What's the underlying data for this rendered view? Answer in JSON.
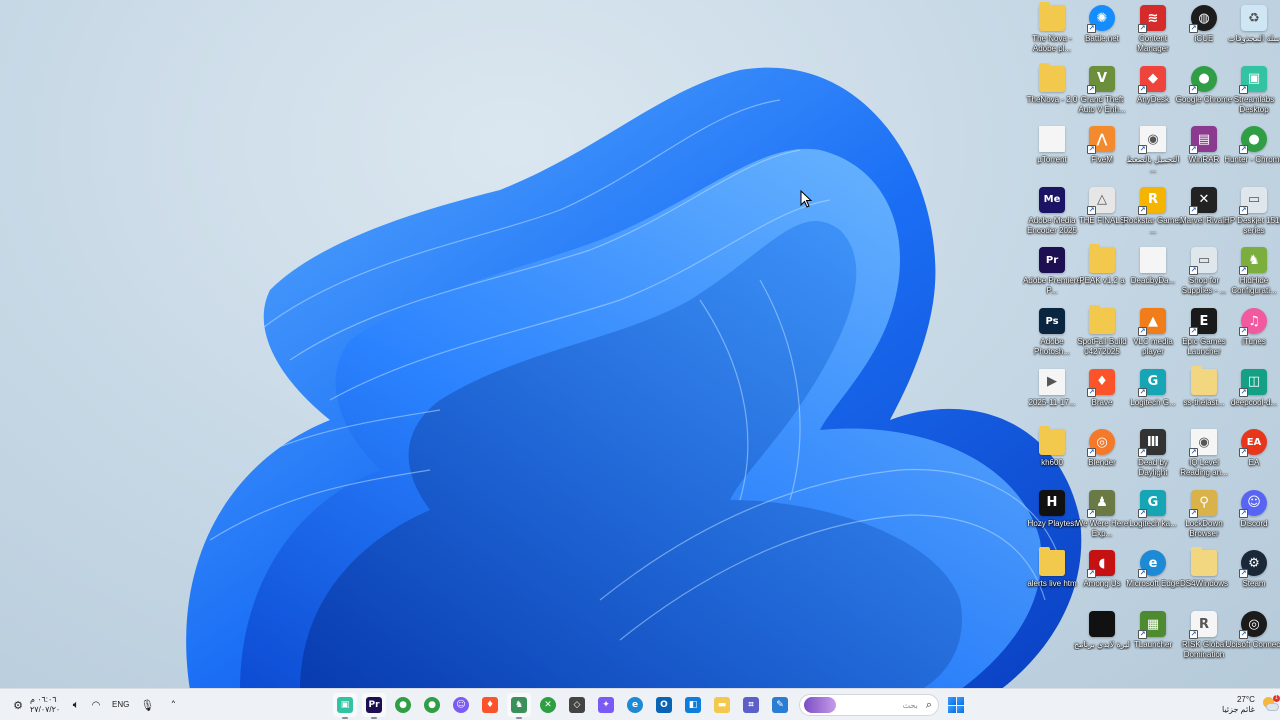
{
  "desktop_icons": [
    {
      "label": "The Nova - Adobe pl...",
      "col": 0,
      "row": 0,
      "color": "#f2c94c",
      "kind": "folder",
      "glyph": "",
      "shortcut": false
    },
    {
      "label": "Battle.net",
      "col": 1,
      "row": 0,
      "color": "#148eff",
      "kind": "round",
      "glyph": "✺",
      "shortcut": true
    },
    {
      "label": "Content Manager",
      "col": 2,
      "row": 0,
      "color": "#d62b2b",
      "kind": "tile",
      "glyph": "≋",
      "shortcut": true
    },
    {
      "label": "iCUE",
      "col": 3,
      "row": 0,
      "color": "#1d1d1d",
      "kind": "round",
      "glyph": "◍",
      "shortcut": true
    },
    {
      "label": "سلة المحذوفات",
      "col": 4,
      "row": 0,
      "color": "#cfe6f4",
      "kind": "tile",
      "glyph": "♻",
      "shortcut": false
    },
    {
      "label": "TheNova - 2.0",
      "col": 0,
      "row": 1,
      "color": "#f2c94c",
      "kind": "folder",
      "glyph": "",
      "shortcut": false
    },
    {
      "label": "Grand Theft Auto V Enh...",
      "col": 1,
      "row": 1,
      "color": "#6b8f3a",
      "kind": "tile",
      "glyph": "V",
      "shortcut": true
    },
    {
      "label": "AnyDesk",
      "col": 2,
      "row": 1,
      "color": "#ef443b",
      "kind": "tile",
      "glyph": "◆",
      "shortcut": true
    },
    {
      "label": "Google Chrome",
      "col": 3,
      "row": 1,
      "color": "#2f9e44",
      "kind": "round",
      "glyph": "●",
      "shortcut": true
    },
    {
      "label": "Streamlabs Desktop",
      "col": 4,
      "row": 1,
      "color": "#31c3a2",
      "kind": "tile",
      "glyph": "▣",
      "shortcut": true
    },
    {
      "label": "µTorrent",
      "col": 0,
      "row": 2,
      "color": "#f5f5f5",
      "kind": "doc",
      "glyph": "",
      "shortcut": false
    },
    {
      "label": "FiveM",
      "col": 1,
      "row": 2,
      "color": "#f38a2e",
      "kind": "tile",
      "glyph": "⋀",
      "shortcut": true
    },
    {
      "label": "التحميل بالضغط ...",
      "col": 2,
      "row": 2,
      "color": "#f5f5f5",
      "kind": "doc",
      "glyph": "◉",
      "shortcut": true
    },
    {
      "label": "WinRAR",
      "col": 3,
      "row": 2,
      "color": "#8b3a8f",
      "kind": "tile",
      "glyph": "▤",
      "shortcut": true
    },
    {
      "label": "Hunter - Chrome",
      "col": 4,
      "row": 2,
      "color": "#2f9e44",
      "kind": "round",
      "glyph": "●",
      "shortcut": true
    },
    {
      "label": "Adobe Media Encoder 2025",
      "col": 0,
      "row": 3,
      "color": "#1b1464",
      "kind": "tile",
      "glyph": "Me",
      "shortcut": false
    },
    {
      "label": "THE FINALS",
      "col": 1,
      "row": 3,
      "color": "#e6e6e6",
      "kind": "tile",
      "glyph": "△",
      "shortcut": true
    },
    {
      "label": "Rockstar Games ...",
      "col": 2,
      "row": 3,
      "color": "#f5b400",
      "kind": "tile",
      "glyph": "R",
      "shortcut": true
    },
    {
      "label": "Marvel Rivals",
      "col": 3,
      "row": 3,
      "color": "#222222",
      "kind": "tile",
      "glyph": "✕",
      "shortcut": true
    },
    {
      "label": "HP Deskjet 1510 series",
      "col": 4,
      "row": 3,
      "color": "#dfe6ec",
      "kind": "tile",
      "glyph": "▭",
      "shortcut": true
    },
    {
      "label": "Adobe Premiere P...",
      "col": 0,
      "row": 4,
      "color": "#1d0f52",
      "kind": "tile",
      "glyph": "Pr",
      "shortcut": false
    },
    {
      "label": "PEAK v1.2 a",
      "col": 1,
      "row": 4,
      "color": "#f2c94c",
      "kind": "folder",
      "glyph": "",
      "shortcut": false
    },
    {
      "label": "DeadbyDa...",
      "col": 2,
      "row": 4,
      "color": "#f5f5f5",
      "kind": "doc",
      "glyph": "",
      "shortcut": false
    },
    {
      "label": "Shop for Supplies - ...",
      "col": 3,
      "row": 4,
      "color": "#dfe6ec",
      "kind": "tile",
      "glyph": "▭",
      "shortcut": true
    },
    {
      "label": "HidHide Configurati...",
      "col": 4,
      "row": 4,
      "color": "#7cae3e",
      "kind": "tile",
      "glyph": "♞",
      "shortcut": true
    },
    {
      "label": "Adobe Photosh...",
      "col": 0,
      "row": 5,
      "color": "#0a2540",
      "kind": "tile",
      "glyph": "Ps",
      "shortcut": false
    },
    {
      "label": "SpotFall Build 04272025",
      "col": 1,
      "row": 5,
      "color": "#f2c94c",
      "kind": "folder",
      "glyph": "",
      "shortcut": false
    },
    {
      "label": "VLC media player",
      "col": 2,
      "row": 5,
      "color": "#f07d1a",
      "kind": "tile",
      "glyph": "▲",
      "shortcut": true
    },
    {
      "label": "Epic Games Launcher",
      "col": 3,
      "row": 5,
      "color": "#1a1a1a",
      "kind": "tile",
      "glyph": "E",
      "shortcut": true
    },
    {
      "label": "iTunes",
      "col": 4,
      "row": 5,
      "color": "#f25aa0",
      "kind": "round",
      "glyph": "♫",
      "shortcut": true
    },
    {
      "label": "2025-11-17...",
      "col": 0,
      "row": 6,
      "color": "#f5f5f5",
      "kind": "doc",
      "glyph": "▶",
      "shortcut": false
    },
    {
      "label": "Brave",
      "col": 1,
      "row": 6,
      "color": "#fb542b",
      "kind": "tile",
      "glyph": "♦",
      "shortcut": true
    },
    {
      "label": "Logitech G...",
      "col": 2,
      "row": 6,
      "color": "#16a5b5",
      "kind": "tile",
      "glyph": "G",
      "shortcut": true
    },
    {
      "label": "ss-thelast...",
      "col": 3,
      "row": 6,
      "color": "#f2d680",
      "kind": "folder",
      "glyph": "",
      "shortcut": false
    },
    {
      "label": "deepcool-d...",
      "col": 4,
      "row": 6,
      "color": "#14a085",
      "kind": "tile",
      "glyph": "◫",
      "shortcut": true
    },
    {
      "label": "kh600",
      "col": 0,
      "row": 7,
      "color": "#f2c94c",
      "kind": "folder",
      "glyph": "",
      "shortcut": false
    },
    {
      "label": "Blender",
      "col": 1,
      "row": 7,
      "color": "#f5792a",
      "kind": "round",
      "glyph": "◎",
      "shortcut": true
    },
    {
      "label": "Dead by Daylight",
      "col": 2,
      "row": 7,
      "color": "#333333",
      "kind": "tile",
      "glyph": "Ⅲ",
      "shortcut": true
    },
    {
      "label": "IQ Level Reading an...",
      "col": 3,
      "row": 7,
      "color": "#f5f5f5",
      "kind": "doc",
      "glyph": "◉",
      "shortcut": true
    },
    {
      "label": "EA",
      "col": 4,
      "row": 7,
      "color": "#e8361c",
      "kind": "round",
      "glyph": "EA",
      "shortcut": true
    },
    {
      "label": "Hozy Playtest",
      "col": 0,
      "row": 8,
      "color": "#111111",
      "kind": "tile",
      "glyph": "H",
      "shortcut": false
    },
    {
      "label": "We Were Here Exp...",
      "col": 1,
      "row": 8,
      "color": "#6b7a45",
      "kind": "tile",
      "glyph": "♟",
      "shortcut": true
    },
    {
      "label": "Logitech ka...",
      "col": 2,
      "row": 8,
      "color": "#16a5b5",
      "kind": "tile",
      "glyph": "G",
      "shortcut": true
    },
    {
      "label": "LockDown Browser",
      "col": 3,
      "row": 8,
      "color": "#d9b24a",
      "kind": "tile",
      "glyph": "⚲",
      "shortcut": true
    },
    {
      "label": "Discord",
      "col": 4,
      "row": 8,
      "color": "#5865f2",
      "kind": "round",
      "glyph": "☺",
      "shortcut": true
    },
    {
      "label": "alerts live htm",
      "col": 0,
      "row": 9,
      "color": "#f2c94c",
      "kind": "folder",
      "glyph": "",
      "shortcut": false
    },
    {
      "label": "Among Us",
      "col": 1,
      "row": 9,
      "color": "#c51111",
      "kind": "tile",
      "glyph": "◖",
      "shortcut": true
    },
    {
      "label": "Microsoft Edge",
      "col": 2,
      "row": 9,
      "color": "#1d8ad6",
      "kind": "round",
      "glyph": "e",
      "shortcut": true
    },
    {
      "label": "DS4Windows",
      "col": 3,
      "row": 9,
      "color": "#f2d680",
      "kind": "folder",
      "glyph": "",
      "shortcut": false
    },
    {
      "label": "Steam",
      "col": 4,
      "row": 9,
      "color": "#1b2838",
      "kind": "round",
      "glyph": "⚙",
      "shortcut": true
    },
    {
      "label": "ليرة لابدي برنامج",
      "col": 1,
      "row": 10,
      "color": "#111111",
      "kind": "tile",
      "glyph": "",
      "shortcut": false
    },
    {
      "label": "TLauncher",
      "col": 2,
      "row": 10,
      "color": "#4e8a2f",
      "kind": "tile",
      "glyph": "▦",
      "shortcut": true
    },
    {
      "label": "RISK Global Domination",
      "col": 3,
      "row": 10,
      "color": "#f5f5f5",
      "kind": "tile",
      "glyph": "R",
      "shortcut": true
    },
    {
      "label": "Ubisoft Connect",
      "col": 4,
      "row": 10,
      "color": "#1b1b1b",
      "kind": "round",
      "glyph": "◎",
      "shortcut": true
    }
  ],
  "taskbar": {
    "weather": {
      "temp": "27°C",
      "desc": "غائم جزئيا"
    },
    "start_icon": "windows-icon",
    "search_placeholder": "بحث",
    "apps": [
      {
        "name": "mspaint-icon",
        "color": "#2b7cd3",
        "glyph": "✎",
        "round": false,
        "active": false
      },
      {
        "name": "snipping-tool-icon",
        "color": "#5b5fc7",
        "glyph": "⌗",
        "round": false,
        "active": false
      },
      {
        "name": "file-explorer-icon",
        "color": "#f2c94c",
        "glyph": "▬",
        "round": false,
        "active": false
      },
      {
        "name": "microsoft-store-icon",
        "color": "#0f7ddb",
        "glyph": "◧",
        "round": false,
        "active": false
      },
      {
        "name": "outlook-icon",
        "color": "#0a64b4",
        "glyph": "O",
        "round": false,
        "active": false
      },
      {
        "name": "edge-icon",
        "color": "#1d8ad6",
        "glyph": "e",
        "round": true,
        "active": false
      },
      {
        "name": "copilot-icon",
        "color": "#7a5af5",
        "glyph": "✦",
        "round": false,
        "active": false
      },
      {
        "name": "unity-hub-icon",
        "color": "#444444",
        "glyph": "◇",
        "round": false,
        "active": false
      },
      {
        "name": "xbox-icon",
        "color": "#2ea043",
        "glyph": "✕",
        "round": true,
        "active": false
      },
      {
        "name": "hidhide-icon",
        "color": "#3a8f5a",
        "glyph": "♞",
        "round": false,
        "active": true
      },
      {
        "name": "brave-icon",
        "color": "#fb542b",
        "glyph": "♦",
        "round": false,
        "active": false
      },
      {
        "name": "discord-icon",
        "color": "#7b5cf0",
        "glyph": "☺",
        "round": true,
        "active": false
      },
      {
        "name": "chrome-profile-icon",
        "color": "#2f9e44",
        "glyph": "●",
        "round": true,
        "active": false
      },
      {
        "name": "chrome-icon",
        "color": "#2f9e44",
        "glyph": "●",
        "round": true,
        "active": false
      },
      {
        "name": "premiere-pro-icon",
        "color": "#1d0f52",
        "glyph": "Pr",
        "round": false,
        "active": true
      },
      {
        "name": "streamlabs-icon",
        "color": "#31c3a2",
        "glyph": "▣",
        "round": false,
        "active": true
      }
    ],
    "language": "ENG",
    "clock": {
      "time": "٠٦:٠٦ م",
      "date": "٢٧/٠٧/٢٠"
    }
  }
}
